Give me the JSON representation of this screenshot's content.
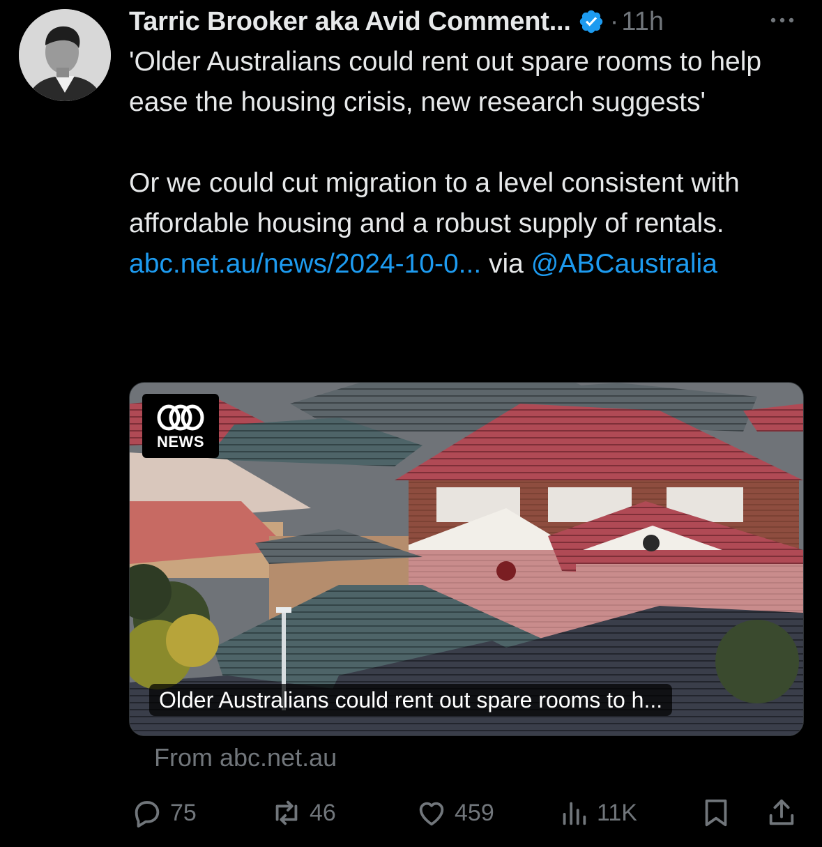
{
  "tweet": {
    "author_name": "Tarric Brooker aka Avid Comment...",
    "verified_icon": "verified-badge-icon",
    "separator": "·",
    "time": "11h",
    "text_p1": "'Older Australians could rent out spare rooms to help ease the housing crisis, new research suggests'",
    "text_p2_start": "Or we could cut migration to a level consistent with affordable housing and a robust supply of rentals. ",
    "link_text": "abc.net.au/news/2024-10-0...",
    "via_text": " via ",
    "mention": "@ABCaustralia"
  },
  "card": {
    "logo_text": "NEWS",
    "title": "Older Australians could rent out spare rooms to h...",
    "source": "From abc.net.au"
  },
  "actions": {
    "replies": "75",
    "reposts": "46",
    "likes": "459",
    "views": "11K"
  },
  "colors": {
    "background": "#000000",
    "text": "#e7e9ea",
    "muted": "#71767b",
    "link": "#1d9bf0"
  }
}
